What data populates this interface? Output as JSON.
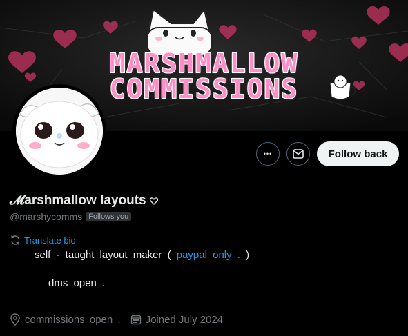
{
  "banner": {
    "title_line1": "MARSHMALLOW",
    "title_line2": "COMMISSIONS"
  },
  "actions": {
    "more_label": "•••",
    "follow_label": "Follow back"
  },
  "profile": {
    "display_name": "𝓜arshmallow layouts",
    "handle": "@marshycomms",
    "follows_you": "Follows you",
    "translate_label": "Translate bio",
    "bio_line1_start": "self - taught layout maker (",
    "bio_line1_link": "paypal only .",
    "bio_line1_end": ")",
    "bio_line2": "dms open .",
    "location": "commissions open .",
    "joined": "Joined July 2024"
  },
  "colors": {
    "accent": "#1d9bf0",
    "banner_text": "#ff8ec6",
    "background": "#000000"
  }
}
